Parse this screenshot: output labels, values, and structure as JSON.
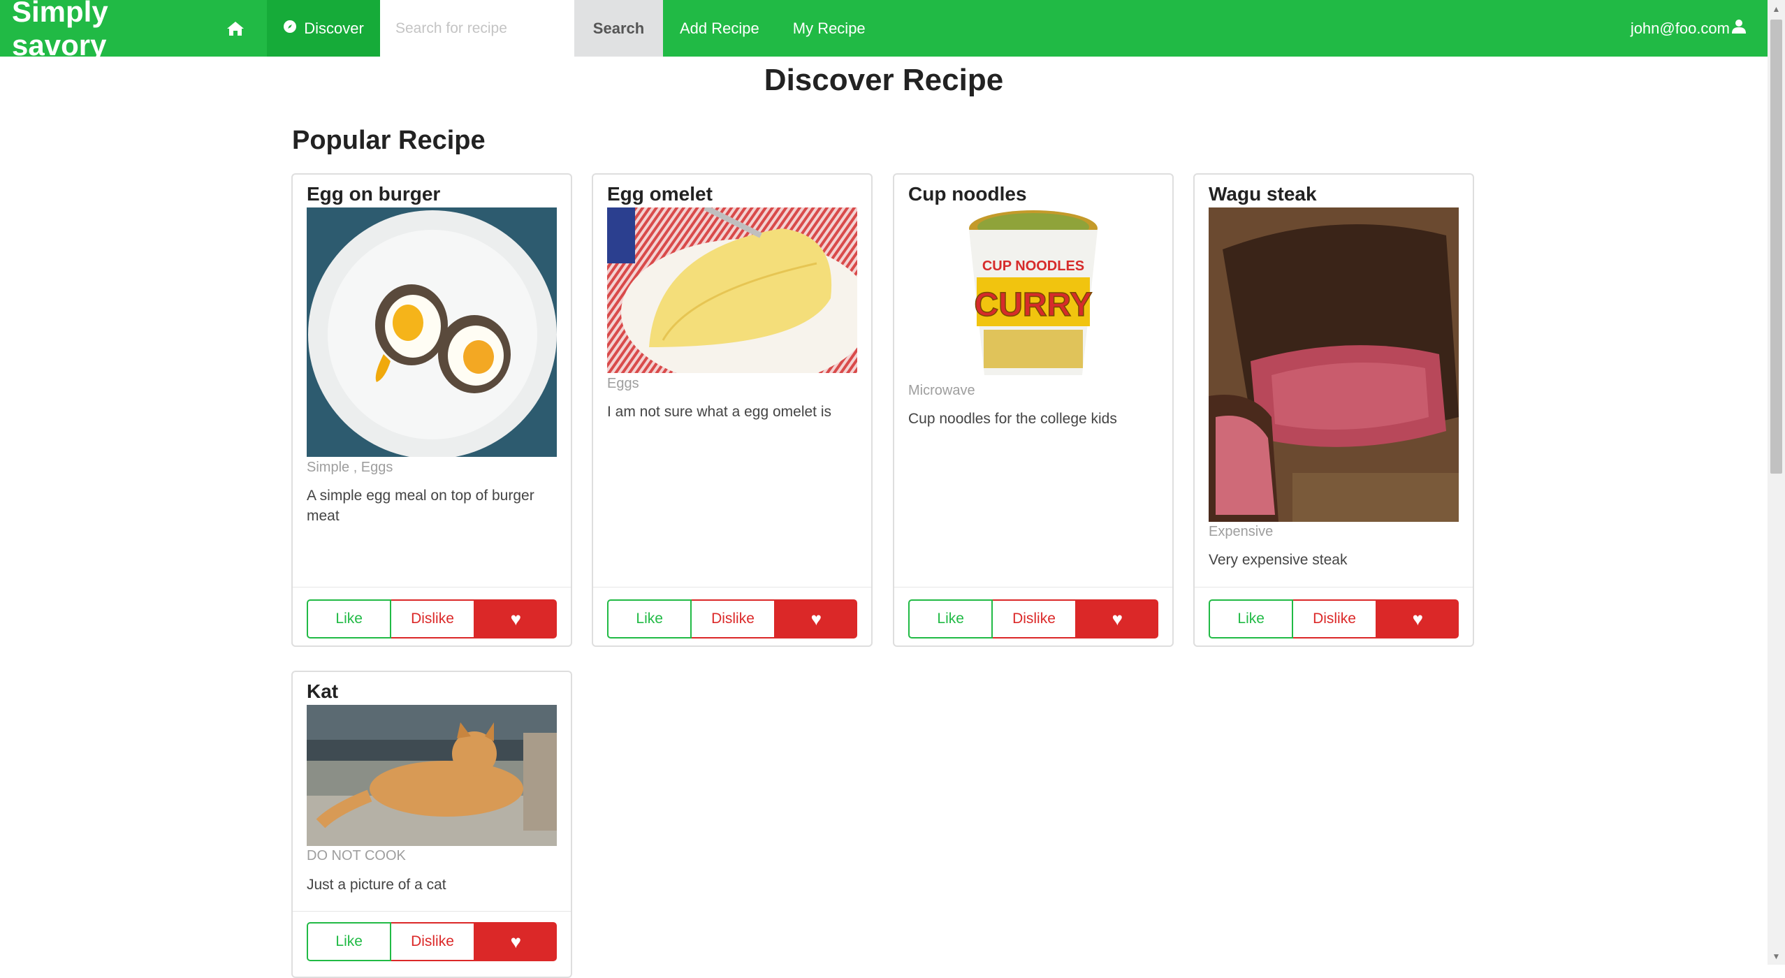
{
  "navbar": {
    "brand": "Simply savory",
    "home_icon": "home-icon",
    "discover_label": "Discover",
    "discover_icon": "compass-icon",
    "search_placeholder": "Search for recipe",
    "search_value": "",
    "search_button": "Search",
    "add_recipe": "Add Recipe",
    "my_recipe": "My Recipe",
    "user_email": "john@foo.com",
    "user_icon": "user-icon"
  },
  "page": {
    "title": "Discover Recipe",
    "section_title": "Popular Recipe"
  },
  "recipes": [
    {
      "title": "Egg on burger",
      "tags": "Simple , Eggs",
      "description": "A simple egg meal on top of burger meat",
      "image": "egg-burger-image",
      "like": "Like",
      "dislike": "Dislike",
      "favorite_icon": "heart-icon"
    },
    {
      "title": "Egg omelet",
      "tags": "Eggs",
      "description": "I am not sure what a egg omelet is",
      "image": "omelet-image",
      "like": "Like",
      "dislike": "Dislike",
      "favorite_icon": "heart-icon"
    },
    {
      "title": "Cup noodles",
      "tags": "Microwave",
      "description": "Cup noodles for the college kids",
      "image": "cup-noodles-image",
      "cup_text_top": "CUP NOODLES",
      "cup_text_main": "CURRY",
      "like": "Like",
      "dislike": "Dislike",
      "favorite_icon": "heart-icon"
    },
    {
      "title": "Wagu steak",
      "tags": "Expensive",
      "description": "Very expensive steak",
      "image": "steak-image",
      "like": "Like",
      "dislike": "Dislike",
      "favorite_icon": "heart-icon"
    },
    {
      "title": "Kat",
      "tags": "DO NOT COOK",
      "description": "Just a picture of a cat",
      "image": "cat-image",
      "like": "Like",
      "dislike": "Dislike",
      "favorite_icon": "heart-icon"
    }
  ],
  "colors": {
    "navbar": "#21ba45",
    "navbar_active": "#16ab39",
    "like": "#21ba45",
    "dislike": "#db2828"
  }
}
